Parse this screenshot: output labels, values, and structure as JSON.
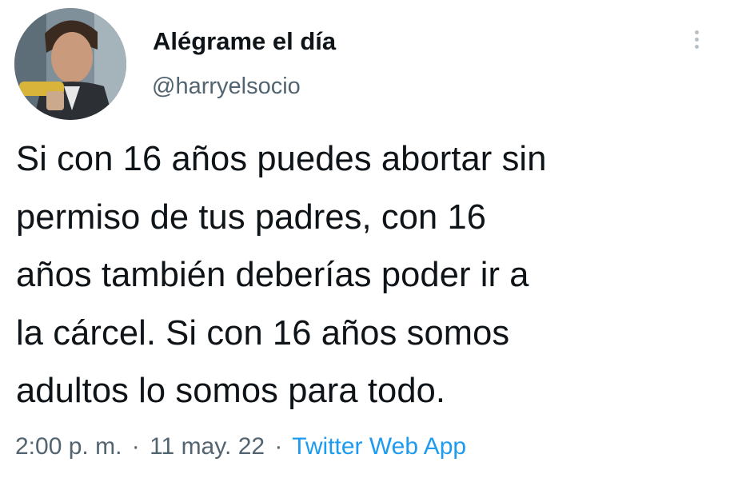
{
  "author": {
    "display_name": "Alégrame el día",
    "handle": "@harryelsocio",
    "avatar_icon": "profile-photo"
  },
  "tweet": {
    "lines": [
      "Si con 16 años puedes abortar sin",
      "permiso de tus padres, con 16",
      "años también deberías poder ir a",
      "la cárcel. Si con 16 años somos",
      "adultos lo somos para todo."
    ]
  },
  "meta": {
    "time": "2:00 p. m.",
    "separator": "·",
    "date": "11 may. 22",
    "source": "Twitter Web App"
  },
  "icons": {
    "more": "more-options-icon"
  },
  "colors": {
    "text": "#0f1419",
    "secondary": "#536471",
    "link": "#1d9bf0"
  }
}
